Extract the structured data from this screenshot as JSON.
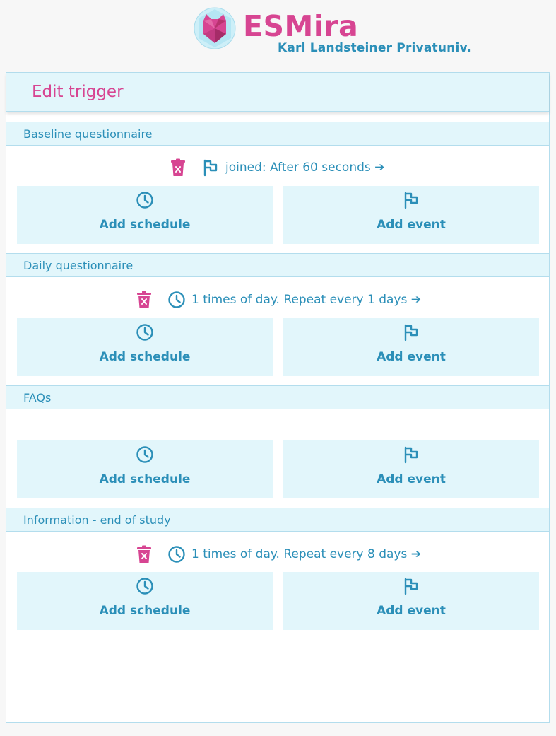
{
  "app": {
    "title": "ESMira",
    "subtitle": "Karl Landsteiner Privatuniv.",
    "logo_icon": "esmira-cat-logo-icon"
  },
  "panel": {
    "title": "Edit trigger"
  },
  "colors": {
    "brand_pink": "#d74592",
    "accent_blue": "#2b8fb8",
    "light_blue_bg": "#e2f6fb",
    "border_blue": "#b3dded"
  },
  "questionnaires": [
    {
      "name": "Baseline questionnaire",
      "trigger": {
        "kind_icon": "flag-icon",
        "text": "joined: After 60 seconds ➔"
      },
      "add_schedule_label": "Add schedule",
      "add_event_label": "Add event"
    },
    {
      "name": "Daily questionnaire",
      "trigger": {
        "kind_icon": "clock-icon",
        "text": "1 times of day. Repeat every 1 days ➔"
      },
      "add_schedule_label": "Add schedule",
      "add_event_label": "Add event"
    },
    {
      "name": "FAQs",
      "trigger": null,
      "add_schedule_label": "Add schedule",
      "add_event_label": "Add event"
    },
    {
      "name": "Information - end of study",
      "trigger": {
        "kind_icon": "clock-icon",
        "text": "1 times of day. Repeat every 8 days ➔"
      },
      "add_schedule_label": "Add schedule",
      "add_event_label": "Add event"
    }
  ]
}
